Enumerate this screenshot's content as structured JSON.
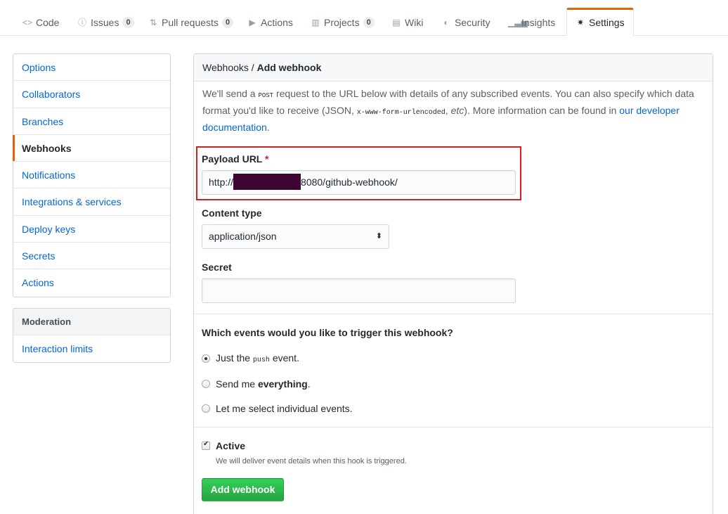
{
  "tabs": [
    {
      "label": "Code",
      "icon": "code-icon"
    },
    {
      "label": "Issues",
      "icon": "issue-icon",
      "count": "0"
    },
    {
      "label": "Pull requests",
      "icon": "pull-request-icon",
      "count": "0"
    },
    {
      "label": "Actions",
      "icon": "play-icon"
    },
    {
      "label": "Projects",
      "icon": "project-icon",
      "count": "0"
    },
    {
      "label": "Wiki",
      "icon": "book-icon"
    },
    {
      "label": "Security",
      "icon": "shield-icon"
    },
    {
      "label": "Insights",
      "icon": "graph-icon"
    },
    {
      "label": "Settings",
      "icon": "gear-icon"
    }
  ],
  "sidebar": {
    "items": [
      "Options",
      "Collaborators",
      "Branches",
      "Webhooks",
      "Notifications",
      "Integrations & services",
      "Deploy keys",
      "Secrets",
      "Actions"
    ],
    "selected": "Webhooks",
    "moderation_heading": "Moderation",
    "moderation_items": [
      "Interaction limits"
    ]
  },
  "main": {
    "breadcrumb_parent": "Webhooks",
    "breadcrumb_separator": " / ",
    "breadcrumb_current": "Add webhook",
    "intro": {
      "part1": "We'll send a ",
      "post": "POST",
      "part2": " request to the URL below with details of any subscribed events. You can also specify which data format you'd like to receive (JSON, ",
      "urlencoded": "x-www-form-urlencoded",
      "part3": ", ",
      "etc": "etc",
      "part4": "). More information can be found in ",
      "link": "our developer documentation",
      "part5": "."
    },
    "payload_label": "Payload URL",
    "required_mark": "*",
    "payload_prefix": "http://",
    "payload_suffix": "8080/github-webhook/",
    "content_type_label": "Content type",
    "content_type_value": "application/json",
    "secret_label": "Secret",
    "secret_value": "",
    "events_question": "Which events would you like to trigger this webhook?",
    "events": {
      "just_push_prefix": "Just the ",
      "just_push_code": "push",
      "just_push_suffix": " event.",
      "everything_prefix": "Send me ",
      "everything_bold": "everything",
      "everything_suffix": ".",
      "individual": "Let me select individual events."
    },
    "active_label": "Active",
    "active_note": "We will deliver event details when this hook is triggered.",
    "submit_label": "Add webhook"
  },
  "colors": {
    "accent": "#e36209",
    "link": "#0366d6",
    "primary_button": "#28a745",
    "highlight_box": "#d0201f"
  }
}
